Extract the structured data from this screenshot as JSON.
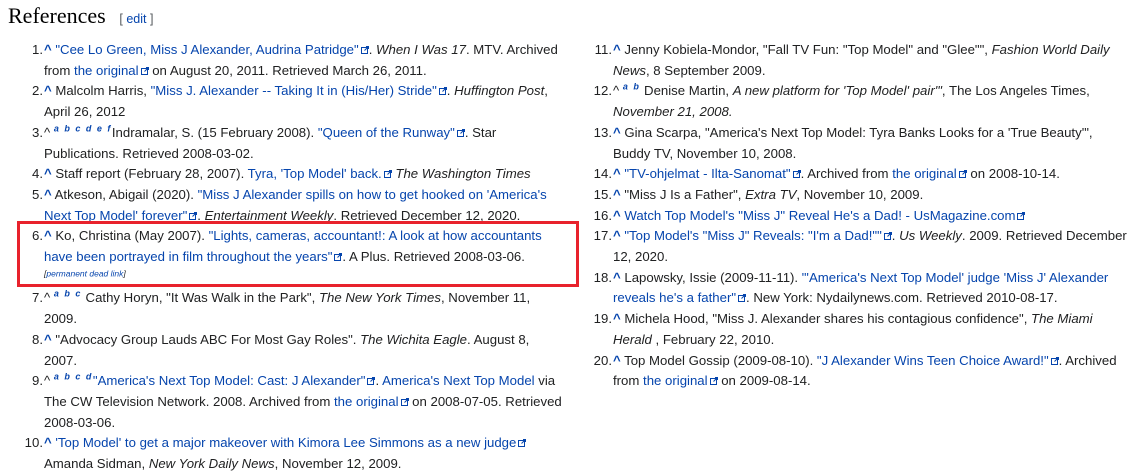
{
  "heading": {
    "title": "References",
    "edit_open": "[",
    "edit": "edit",
    "edit_close": "]"
  },
  "refs": {
    "r1": {
      "num": "1.",
      "caret": "^",
      "link": "\"Cee Lo Green, Miss J Alexander, Audrina Patridge\"",
      "work": "When I Was 17",
      "t1": ". MTV. Archived from ",
      "orig": "the original",
      "t2": " on August 20, 2011. Retrieved March 26, 2011."
    },
    "r2": {
      "num": "2.",
      "caret": "^",
      "t0": " Malcolm Harris, ",
      "link": "\"Miss J. Alexander -- Taking It in (His/Her) Stride\"",
      "t1": ". ",
      "work": "Huffington Post",
      "t2": ", April 26, 2012"
    },
    "r3": {
      "num": "3.",
      "caret": "^",
      "letters": "a b c d e f",
      "t0": "Indramalar, S. (15 February 2008). ",
      "link": "\"Queen of the Runway\"",
      "t1": ". Star Publications. Retrieved 2008-03-02."
    },
    "r4": {
      "num": "4.",
      "caret": "^",
      "t0": " Staff report (February 28, 2007). ",
      "link": "Tyra, 'Top Model' back.",
      "work": "The Washington Times"
    },
    "r5": {
      "num": "5.",
      "caret": "^",
      "t0": " Atkeson, Abigail (2020). ",
      "link": "\"Miss J Alexander spills on how to get hooked on 'America's Next Top Model' forever\"",
      "t1": ". ",
      "work": "Entertainment Weekly",
      "t2": ". Retrieved December 12, 2020."
    },
    "r6": {
      "num": "6.",
      "caret": "^",
      "t0": " Ko, Christina (May 2007). ",
      "link": "\"Lights, cameras, accountant!: A look at how accountants have been portrayed in film throughout the years\"",
      "t1": ". A Plus. Retrieved 2008-03-06.",
      "dead": "permanent dead link"
    },
    "r7": {
      "num": "7.",
      "caret": "^",
      "letters": "a b c",
      "t0": " Cathy Horyn, \"It Was Walk in the Park\", ",
      "work": "The New York Times",
      "t2": ", November 11, 2009."
    },
    "r8": {
      "num": "8.",
      "caret": "^",
      "t0": " \"Advocacy Group Lauds ABC For Most Gay Roles\". ",
      "work": "The Wichita Eagle",
      "t2": ". August 8, 2007."
    },
    "r9": {
      "num": "9.",
      "caret": "^",
      "letters": "a b c d",
      "link": "\"America's Next Top Model: Cast: J Alexander\"",
      "t1": ". ",
      "link2": "America's Next Top Model",
      "t2": " via The CW Television Network. 2008. Archived from ",
      "orig": "the original",
      "t3": " on 2008-07-05. Retrieved 2008-03-06."
    },
    "r10": {
      "num": "10.",
      "caret": "^",
      "link": "'Top Model' to get a major makeover with Kimora Lee Simmons as a new judge",
      "t1": " Amanda Sidman, ",
      "work": "New York Daily News",
      "t2": ", November 12, 2009."
    },
    "r11": {
      "num": "11.",
      "caret": "^",
      "t0": " Jenny Kobiela-Mondor, \"Fall TV Fun: \"Top Model\" and \"Glee\"\", ",
      "work": "Fashion World Daily News",
      "t2": ", 8 September 2009."
    },
    "r12": {
      "num": "12.",
      "caret": "^",
      "letters": "a b",
      "t0": " Denise Martin, ",
      "work": "A new platform for 'Top Model' pair'\"",
      "t1": ", The Los Angeles Times, ",
      "work2": "November 21, 2008."
    },
    "r13": {
      "num": "13.",
      "caret": "^",
      "t0": " Gina Scarpa, \"America's Next Top Model: Tyra Banks Looks for a 'True Beauty'\", Buddy TV, November 10, 2008."
    },
    "r14": {
      "num": "14.",
      "caret": "^",
      "link": "\"TV-ohjelmat - Ilta-Sanomat\"",
      "t1": ". Archived from ",
      "orig": "the original",
      "t2": " on 2008-10-14."
    },
    "r15": {
      "num": "15.",
      "caret": "^",
      "t0": " \"Miss J Is a Father\", ",
      "work": "Extra TV",
      "t2": ", November 10, 2009."
    },
    "r16": {
      "num": "16.",
      "caret": "^",
      "link": "Watch Top Model's \"Miss J\" Reveal He's a Dad! - UsMagazine.com"
    },
    "r17": {
      "num": "17.",
      "caret": "^",
      "link": "\"Top Model's \"Miss J\" Reveals: \"I'm a Dad!\"\"",
      "t1": ". ",
      "work": "Us Weekly",
      "t2": ". 2009. Retrieved December 12, 2020."
    },
    "r18": {
      "num": "18.",
      "caret": "^",
      "t0": " Lapowsky, Issie (2009-11-11). ",
      "link": "\"'America's Next Top Model' judge 'Miss J' Alexander reveals he's a father\"",
      "t1": ". New York: Nydailynews.com. Retrieved 2010-08-17."
    },
    "r19": {
      "num": "19.",
      "caret": "^",
      "t0": " Michela Hood, \"Miss J. Alexander shares his contagious confidence\", ",
      "work": "The Miami Herald",
      "t2": " , February 22, 2010."
    },
    "r20": {
      "num": "20.",
      "caret": "^",
      "t0": " Top Model Gossip (2009-08-10). ",
      "link": "\"J Alexander Wins Teen Choice Award!\"",
      "t1": ". Archived from ",
      "orig": "the original",
      "t2": " on 2009-08-14."
    }
  },
  "colors": {
    "link": "#0645ad",
    "text": "#202122",
    "highlight": "#e8222c"
  },
  "icons": {
    "external": "external-link-icon"
  }
}
